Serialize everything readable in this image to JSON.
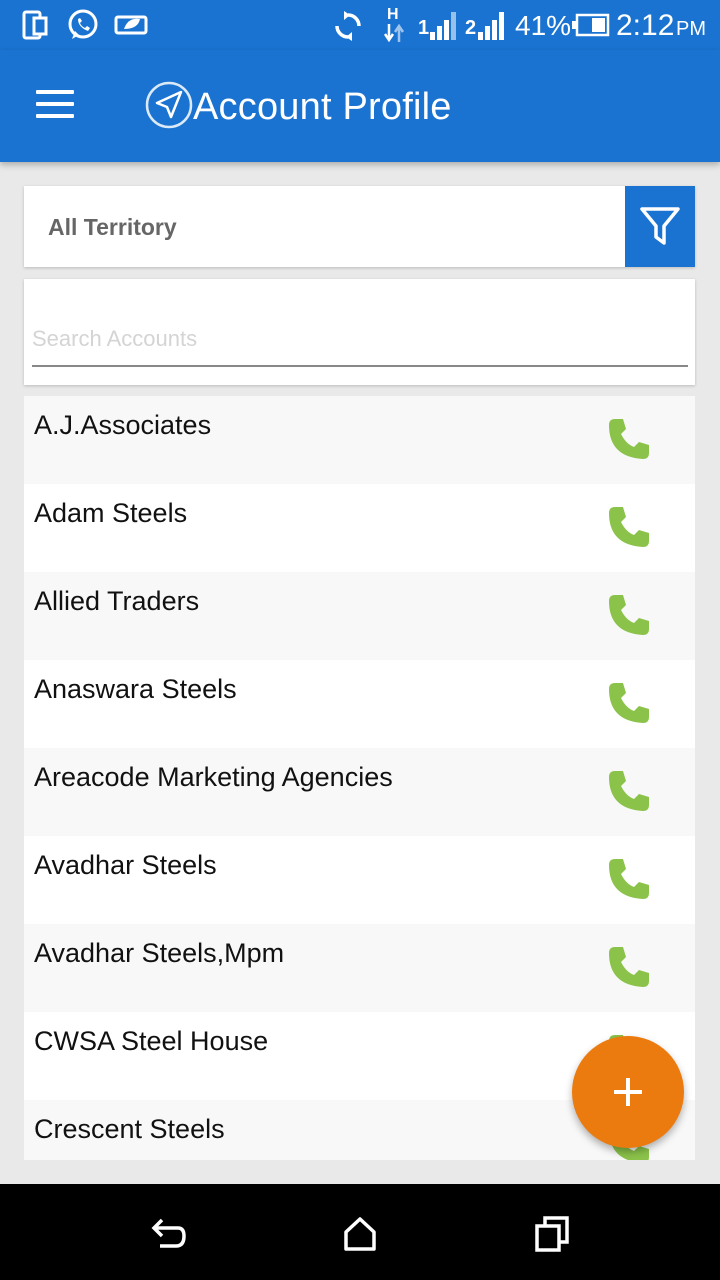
{
  "status_bar": {
    "battery_percent": "41%",
    "time": "2:12",
    "ampm": "PM",
    "sim1_label": "1",
    "sim2_label": "2",
    "network_type": "H"
  },
  "app_bar": {
    "title": "Account Profile"
  },
  "territory": {
    "selected": "All Territory"
  },
  "search": {
    "placeholder": "Search Accounts",
    "value": ""
  },
  "accounts": [
    {
      "name": "A.J.Associates"
    },
    {
      "name": "Adam Steels"
    },
    {
      "name": "Allied Traders"
    },
    {
      "name": "Anaswara Steels"
    },
    {
      "name": "Areacode Marketing Agencies"
    },
    {
      "name": "Avadhar Steels"
    },
    {
      "name": "Avadhar Steels,Mpm"
    },
    {
      "name": "CWSA Steel House"
    },
    {
      "name": "Crescent Steels"
    }
  ],
  "colors": {
    "primary": "#1a73d1",
    "fab": "#eb7b0f",
    "call_icon": "#8bc34a"
  },
  "icons": {
    "menu": "hamburger-menu-icon",
    "filter": "filter-funnel-icon",
    "call": "phone-call-icon",
    "add": "plus-icon",
    "back": "back-icon",
    "home": "home-icon",
    "recents": "recents-icon"
  }
}
